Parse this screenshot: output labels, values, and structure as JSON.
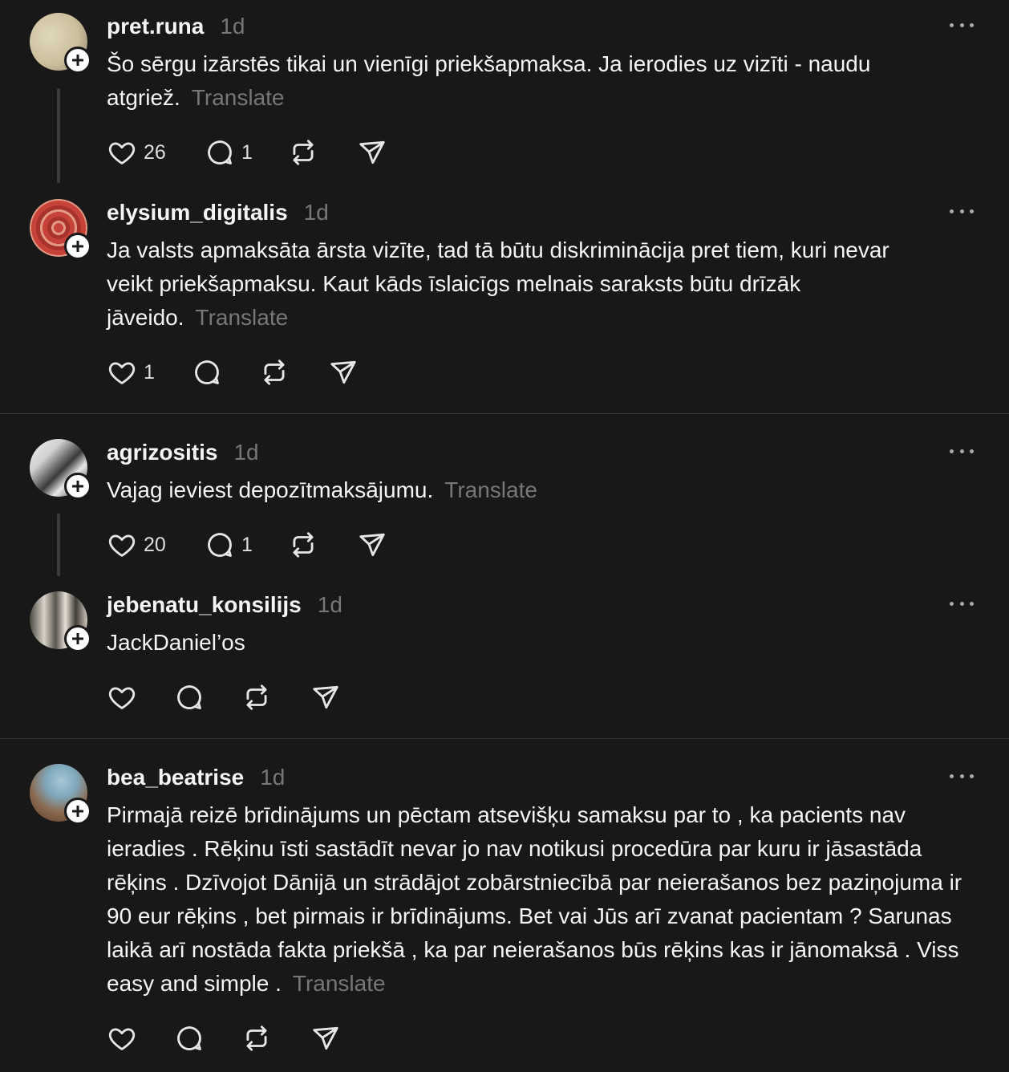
{
  "posts": [
    {
      "username": "pret.runa",
      "time": "1d",
      "text": "Šo sērgu izārstēs tikai un vienīgi priekšapmaksa. Ja ierodies uz vizīti - naudu atgriež.",
      "translate": "Translate",
      "likes": "26",
      "replies": "1",
      "avatar_icon": "avatar-photo",
      "avatar_colors": [
        "#d9cfb0",
        "#8a7f6a"
      ]
    },
    {
      "username": "elysium_digitalis",
      "time": "1d",
      "text": "Ja valsts apmaksāta ārsta vizīte, tad tā būtu diskriminācija pret tiem, kuri nevar veikt priekšapmaksu. Kaut kāds īslaicīgs melnais saraksts būtu drīzāk jāveido.",
      "translate": "Translate",
      "likes": "1",
      "replies": "",
      "avatar_icon": "avatar-photo",
      "avatar_colors": [
        "#c7433a",
        "#e39a84"
      ]
    },
    {
      "username": "agrizositis",
      "time": "1d",
      "text": "Vajag ieviest depozītmaksājumu.",
      "translate": "Translate",
      "likes": "20",
      "replies": "1",
      "avatar_icon": "avatar-photo",
      "avatar_colors": [
        "#f2f2f2",
        "#2a2a2a"
      ]
    },
    {
      "username": "jebenatu_konsilijs",
      "time": "1d",
      "text": "JackDaniel’os",
      "translate": "",
      "likes": "",
      "replies": "",
      "avatar_icon": "avatar-photo",
      "avatar_colors": [
        "#6b6660",
        "#d8d2c8"
      ]
    },
    {
      "username": "bea_beatrise",
      "time": "1d",
      "text": "Pirmajā reizē brīdinājums un pēctam atsevišķu samaksu par to , ka pacients nav ieradies . Rēķinu īsti sastādīt nevar jo nav notikusi procedūra par kuru ir jāsastāda rēķins . Dzīvojot Dānijā un strādājot zobārstniecībā par neierašanos bez paziņojuma ir 90 eur rēķins , bet pirmais ir brīdinājums. Bet vai Jūs arī zvanat pacientam ? Sarunas laikā arī nostāda fakta priekšā , ka par neierašanos būs rēķins kas ir jānomaksā . Viss easy and simple .",
      "translate": "Translate",
      "likes": "",
      "replies": "",
      "avatar_icon": "avatar-photo",
      "avatar_colors": [
        "#a8c7d6",
        "#6e4a34"
      ]
    }
  ],
  "icons": {
    "like": "heart-icon",
    "reply": "comment-icon",
    "repost": "repost-icon",
    "share": "send-icon",
    "more": "more-icon",
    "follow": "plus-icon"
  },
  "colors": {
    "background": "#181818",
    "text": "#f3f5f7",
    "muted": "#777777",
    "divider": "#333333"
  }
}
